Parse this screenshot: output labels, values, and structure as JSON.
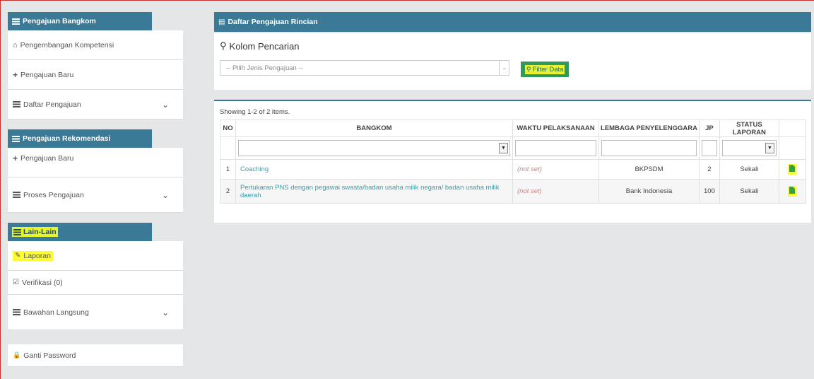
{
  "sidebar": {
    "sections": [
      {
        "title": "Pengajuan Bangkom",
        "items": [
          {
            "label": "Pengembangan Kompetensi",
            "icon": "home-icon"
          },
          {
            "label": "Pengajuan Baru",
            "icon": "plus-icon"
          },
          {
            "label": "Daftar Pengajuan",
            "icon": "list-icon",
            "expandable": true
          }
        ]
      },
      {
        "title": "Pengajuan Rekomendasi",
        "items": [
          {
            "label": "Pengajuan Baru",
            "icon": "plus-icon"
          },
          {
            "label": "Proses Pengajuan",
            "icon": "list-icon",
            "expandable": true
          }
        ]
      },
      {
        "title": "Lain-Lain",
        "items": [
          {
            "label": "Laporan",
            "icon": "edit-icon"
          },
          {
            "label": "Verifikasi ",
            "badge": "(0)",
            "icon": "check-square-icon"
          },
          {
            "label": "Bawahan Langsung",
            "icon": "list-icon",
            "expandable": true
          }
        ]
      }
    ],
    "extra": {
      "label": "Ganti Password",
      "icon": "lock-icon"
    }
  },
  "main": {
    "panel_title": "Daftar Pengajuan Rincian",
    "search": {
      "title": "Kolom Pencarian",
      "select_placeholder": "-- Pilih Jenis Pengajuan --",
      "filter_button": "Filter Data"
    },
    "table": {
      "summary": "Showing 1-2 of 2 items.",
      "headers": [
        "NO",
        "BANGKOM",
        "WAKTU PELAKSANAAN",
        "LEMBAGA PENYELENGGARA",
        "JP",
        "STATUS LAPORAN"
      ],
      "rows": [
        {
          "no": "1",
          "bangkom": "Coaching",
          "waktu": "(not set)",
          "lembaga": "BKPSDM",
          "jp": "2",
          "status": "Sekali"
        },
        {
          "no": "2",
          "bangkom": "Pertukaran PNS dengan pegawai swasta/badan usaha milik negara/ badan usaha milik daerah",
          "waktu": "(not set)",
          "lembaga": "Bank Indonesia",
          "jp": "100",
          "status": "Sekali"
        }
      ]
    }
  },
  "colors": {
    "header": "#3b7a97",
    "filter_button": "#2e9a5c",
    "highlight": "#fbfc35",
    "link": "#3c9ea6"
  }
}
